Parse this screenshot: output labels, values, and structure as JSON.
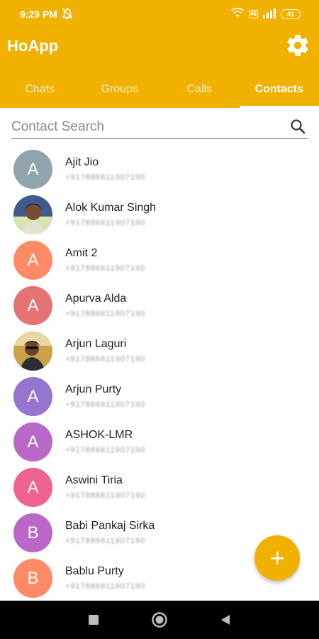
{
  "status_bar": {
    "time": "9:29 PM",
    "battery": "41",
    "sim_badge": "46"
  },
  "app": {
    "title": "HoApp"
  },
  "icons": {
    "settings": "gear-icon",
    "search": "search-icon",
    "add": "plus-icon",
    "mute": "bell-off-icon",
    "wifi": "wifi-icon",
    "signal": "signal-icon",
    "battery": "battery-icon",
    "nav_recents": "square-icon",
    "nav_home": "circle-icon",
    "nav_back": "triangle-back-icon"
  },
  "colors": {
    "accent": "#f0b100",
    "avatar_grey": "#90a4ae",
    "avatar_orange": "#ff8a65",
    "avatar_red": "#e57373",
    "avatar_purple": "#9575cd",
    "avatar_magenta": "#ba68c8",
    "avatar_pink": "#f06292"
  },
  "tabs": [
    {
      "label": "Chats",
      "active": false
    },
    {
      "label": "Groups",
      "active": false
    },
    {
      "label": "Calls",
      "active": false
    },
    {
      "label": "Contacts",
      "active": true
    }
  ],
  "search": {
    "placeholder": "Contact Search",
    "value": ""
  },
  "contacts": [
    {
      "name": "Ajit Jio",
      "initial": "A",
      "color": "#90a4ae",
      "photo": false,
      "phone": "+917886611907190"
    },
    {
      "name": "Alok Kumar Singh",
      "initial": "",
      "color": "#3c4f7a",
      "photo": true,
      "phone": "+917886611907190"
    },
    {
      "name": "Amit 2",
      "initial": "A",
      "color": "#ff8a65",
      "photo": false,
      "phone": "+917886611907190"
    },
    {
      "name": "Apurva Alda",
      "initial": "A",
      "color": "#e57373",
      "photo": false,
      "phone": "+917886611907190"
    },
    {
      "name": "Arjun Laguri",
      "initial": "",
      "color": "#8a7a45",
      "photo": true,
      "phone": "+917886611907190"
    },
    {
      "name": "Arjun Purty",
      "initial": "A",
      "color": "#9575cd",
      "photo": false,
      "phone": "+917886611907190"
    },
    {
      "name": "ASHOK-LMR",
      "initial": "A",
      "color": "#ba68c8",
      "photo": false,
      "phone": "+917886611907190"
    },
    {
      "name": "Aswini Tiria",
      "initial": "A",
      "color": "#f06292",
      "photo": false,
      "phone": "+917886611907190"
    },
    {
      "name": "Babi Pankaj Sirka",
      "initial": "B",
      "color": "#ba68c8",
      "photo": false,
      "phone": "+917886611907190"
    },
    {
      "name": "Bablu Purty",
      "initial": "B",
      "color": "#ff8a65",
      "photo": false,
      "phone": "+917886611907190"
    }
  ]
}
